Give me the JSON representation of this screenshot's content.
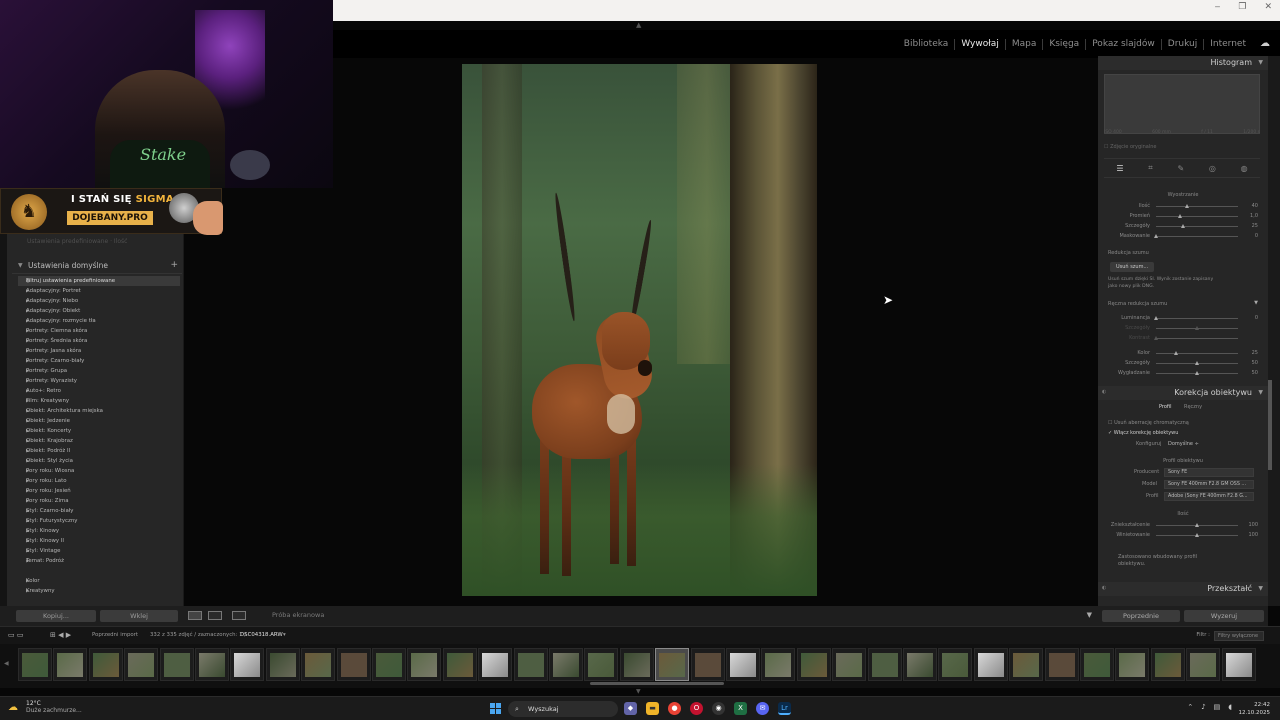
{
  "window": {
    "controls": [
      "‒",
      "❐",
      "✕"
    ]
  },
  "modules": {
    "items": [
      {
        "label": "Biblioteka",
        "active": false
      },
      {
        "label": "Wywołaj",
        "active": true
      },
      {
        "label": "Mapa",
        "active": false
      },
      {
        "label": "Księga",
        "active": false
      },
      {
        "label": "Pokaz slajdów",
        "active": false
      },
      {
        "label": "Drukuj",
        "active": false
      },
      {
        "label": "Internet",
        "active": false
      }
    ]
  },
  "overlay": {
    "shirt_text": "Stake",
    "banner_line1_a": "I STAŃ SIĘ ",
    "banner_line1_b": "SIGMA",
    "banner_line2": "DOJEBANY.PRO"
  },
  "left_panel": {
    "ghost_text": "Ustawienia predefiniowane · Ilość",
    "section_title": "Ustawienia domyślne",
    "filter_item": "Filtruj ustawienia predefiniowane",
    "presets": [
      "Adaptacyjny: Portret",
      "Adaptacyjny: Niebo",
      "Adaptacyjny: Obiekt",
      "Adaptacyjny: rozmycie tła",
      "Portrety: Ciemna skóra",
      "Portrety: Średnia skóra",
      "Portrety: Jasna skóra",
      "Portrety: Czarno-biały",
      "Portrety: Grupa",
      "Portrety: Wyrazisty",
      "Auto+: Retro",
      "Film: Kreatywny",
      "Obiekt: Architektura miejska",
      "Obiekt: Jedzenie",
      "Obiekt: Koncerty",
      "Obiekt: Krajobraz",
      "Obiekt: Podróż II",
      "Obiekt: Styl życia",
      "Pory roku: Wiosna",
      "Pory roku: Lato",
      "Pory roku: Jesień",
      "Pory roku: Zima",
      "Styl: Czarno-biały",
      "Styl: Futurystyczny",
      "Styl: Kinowy",
      "Styl: Kinowy II",
      "Styl: Vintage",
      "Temat: Podróż"
    ],
    "presets_extra": [
      "Kolor",
      "Kreatywny"
    ],
    "copy_button": "Kopiuj...",
    "paste_button": "Wklej"
  },
  "toolbar": {
    "proof_label": "Próba ekranowa"
  },
  "right_panel": {
    "histogram_title": "Histogram",
    "histogram_stats": [
      "ISO 400",
      "600 mm",
      "f / 11",
      "1/200 s"
    ],
    "show_original": "Zdjęcie oryginalne",
    "sharpening": {
      "title": "Wyostrzanie",
      "sliders": [
        {
          "label": "Ilość",
          "value": "40",
          "pos": 0.38,
          "dim": false
        },
        {
          "label": "Promień",
          "value": "1,0",
          "pos": 0.3,
          "dim": false
        },
        {
          "label": "Szczegóły",
          "value": "25",
          "pos": 0.33,
          "dim": false
        },
        {
          "label": "Maskowanie",
          "value": "0",
          "pos": 0.0,
          "dim": false
        }
      ]
    },
    "noise": {
      "title": "Redukcja szumu",
      "remove_button": "Usuń szum...",
      "desc_line1": "Usuń szum dzięki SI. Wynik zostanie zapisany",
      "desc_line2": "jako nowy plik DNG.",
      "manual_title": "Ręczna redukcja szumu",
      "sliders": [
        {
          "label": "Luminancja",
          "value": "0",
          "pos": 0.0,
          "dim": false
        },
        {
          "label": "Szczegóły",
          "value": "",
          "pos": 0.5,
          "dim": true
        },
        {
          "label": "Kontrast",
          "value": "",
          "pos": 0.0,
          "dim": true
        },
        {
          "label": "Kolor",
          "value": "25",
          "pos": 0.25,
          "dim": false
        },
        {
          "label": "Szczegóły",
          "value": "50",
          "pos": 0.5,
          "dim": false
        },
        {
          "label": "Wygładzanie",
          "value": "50",
          "pos": 0.5,
          "dim": false
        }
      ]
    },
    "lens": {
      "title": "Korekcja obiektywu",
      "tab_profile": "Profil",
      "tab_manual": "Ręczny",
      "chk_ca": "Usuń aberrację chromatyczną",
      "chk_profile": "Włącz korekcję obiektywu",
      "config_label": "Konfiguruj",
      "config_value": "Domyślne ÷",
      "profile_title": "Profil obiektywu",
      "maker_label": "Producent",
      "maker_value": "Sony FE",
      "model_label": "Model",
      "model_value": "Sony FE 400mm F2.8 GM OSS ...",
      "profile_label": "Profil",
      "profile_value": "Adobe (Sony FE 400mm F2.8 G...",
      "amount_title": "Ilość",
      "sliders": [
        {
          "label": "Zniekształcenie",
          "value": "100",
          "pos": 0.5,
          "dim": false
        },
        {
          "label": "Winietowanie",
          "value": "100",
          "pos": 0.5,
          "dim": false
        }
      ],
      "note_line1": "Zastosowano wbudowany profil",
      "note_line2": "obiektywu."
    },
    "transform_title": "Przekształć",
    "prev_button": "Poprzednie",
    "reset_button": "Wyzeruj"
  },
  "filmstrip_bar": {
    "prev_import": "Poprzedni import",
    "count_text": "332 z 335 zdjęć / zaznaczonych: 1 /",
    "filename": "DSC04318.ARW",
    "filter_label": "Filtr :",
    "filter_value": "Filtry wyłączone"
  },
  "filmstrip": {
    "count": 35,
    "selected_index": 18
  },
  "taskbar": {
    "temp": "12°C",
    "weather": "Duże zachmurze...",
    "search": "Wyszukaj",
    "time": "22:42",
    "date": "12.10.2025"
  }
}
